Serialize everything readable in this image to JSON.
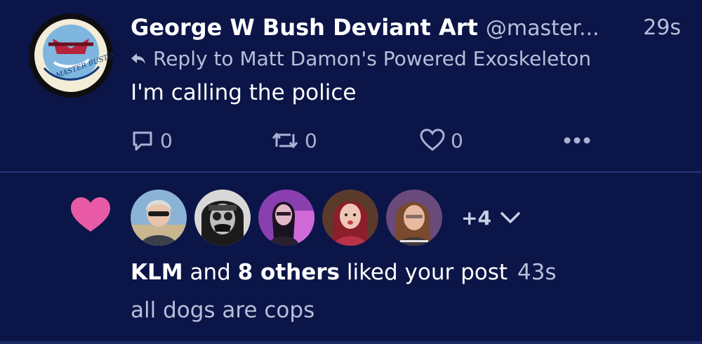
{
  "post": {
    "display_name": "George W Bush Deviant Art",
    "handle": "@master...",
    "time": "29s",
    "reply_to": "Reply to Matt Damon's Powered Exoskeleton",
    "text": "I'm calling the police",
    "avatar_text": "MASTER BUSTOISE",
    "actions": {
      "reply_count": "0",
      "retweet_count": "0",
      "like_count": "0"
    }
  },
  "notification": {
    "more_count": "+4",
    "actor": "KLM",
    "connector": "and",
    "others": "8 others",
    "action": "liked your post",
    "time": "43s",
    "post_preview": "all dogs are cops"
  },
  "colors": {
    "background": "#0b1547",
    "heart": "#e85aa6",
    "muted_text": "#b7bfd9"
  },
  "icons": [
    "reply-arrow-icon",
    "comment-icon",
    "retweet-icon",
    "heart-outline-icon",
    "more-icon",
    "heart-filled-icon",
    "chevron-down-icon"
  ]
}
